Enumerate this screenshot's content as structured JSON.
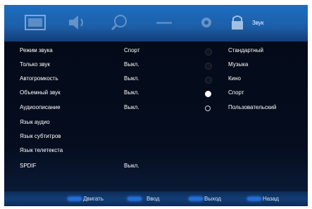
{
  "tabs": {
    "icons": [
      "picture-icon",
      "speaker-icon",
      "search-icon",
      "dash-icon",
      "gear-icon",
      "lock-icon"
    ],
    "active_label": "Звук"
  },
  "menu": {
    "items": [
      {
        "label": "Режим звука",
        "value": "Спорт"
      },
      {
        "label": "Только звук",
        "value": "Выкл."
      },
      {
        "label": "Автогромкость",
        "value": "Выкл."
      },
      {
        "label": "Объемный звук",
        "value": "Выкл."
      },
      {
        "label": "Аудиоописание",
        "value": "Выкл."
      },
      {
        "label": "Язык аудио",
        "value": ""
      },
      {
        "label": "Язык субтитров",
        "value": ""
      },
      {
        "label": "Язык телетекста",
        "value": ""
      },
      {
        "label": "SPDIF",
        "value": "Выкл."
      }
    ]
  },
  "sound_modes": {
    "options": [
      {
        "label": "Стандартный",
        "state": "dim"
      },
      {
        "label": "Музыка",
        "state": "dim"
      },
      {
        "label": "Кино",
        "state": "dim"
      },
      {
        "label": "Спорт",
        "state": "selected"
      },
      {
        "label": "Пользовательский",
        "state": "unselected"
      }
    ]
  },
  "help": {
    "move": "Двигать",
    "enter": "Ввод",
    "exit": "Выход",
    "back": "Назад"
  },
  "colors": {
    "tab_bar": "#1d5ea8",
    "panel": "#050d1f",
    "help_bar": "#123d75",
    "button_glow": "#1e6fd8"
  }
}
